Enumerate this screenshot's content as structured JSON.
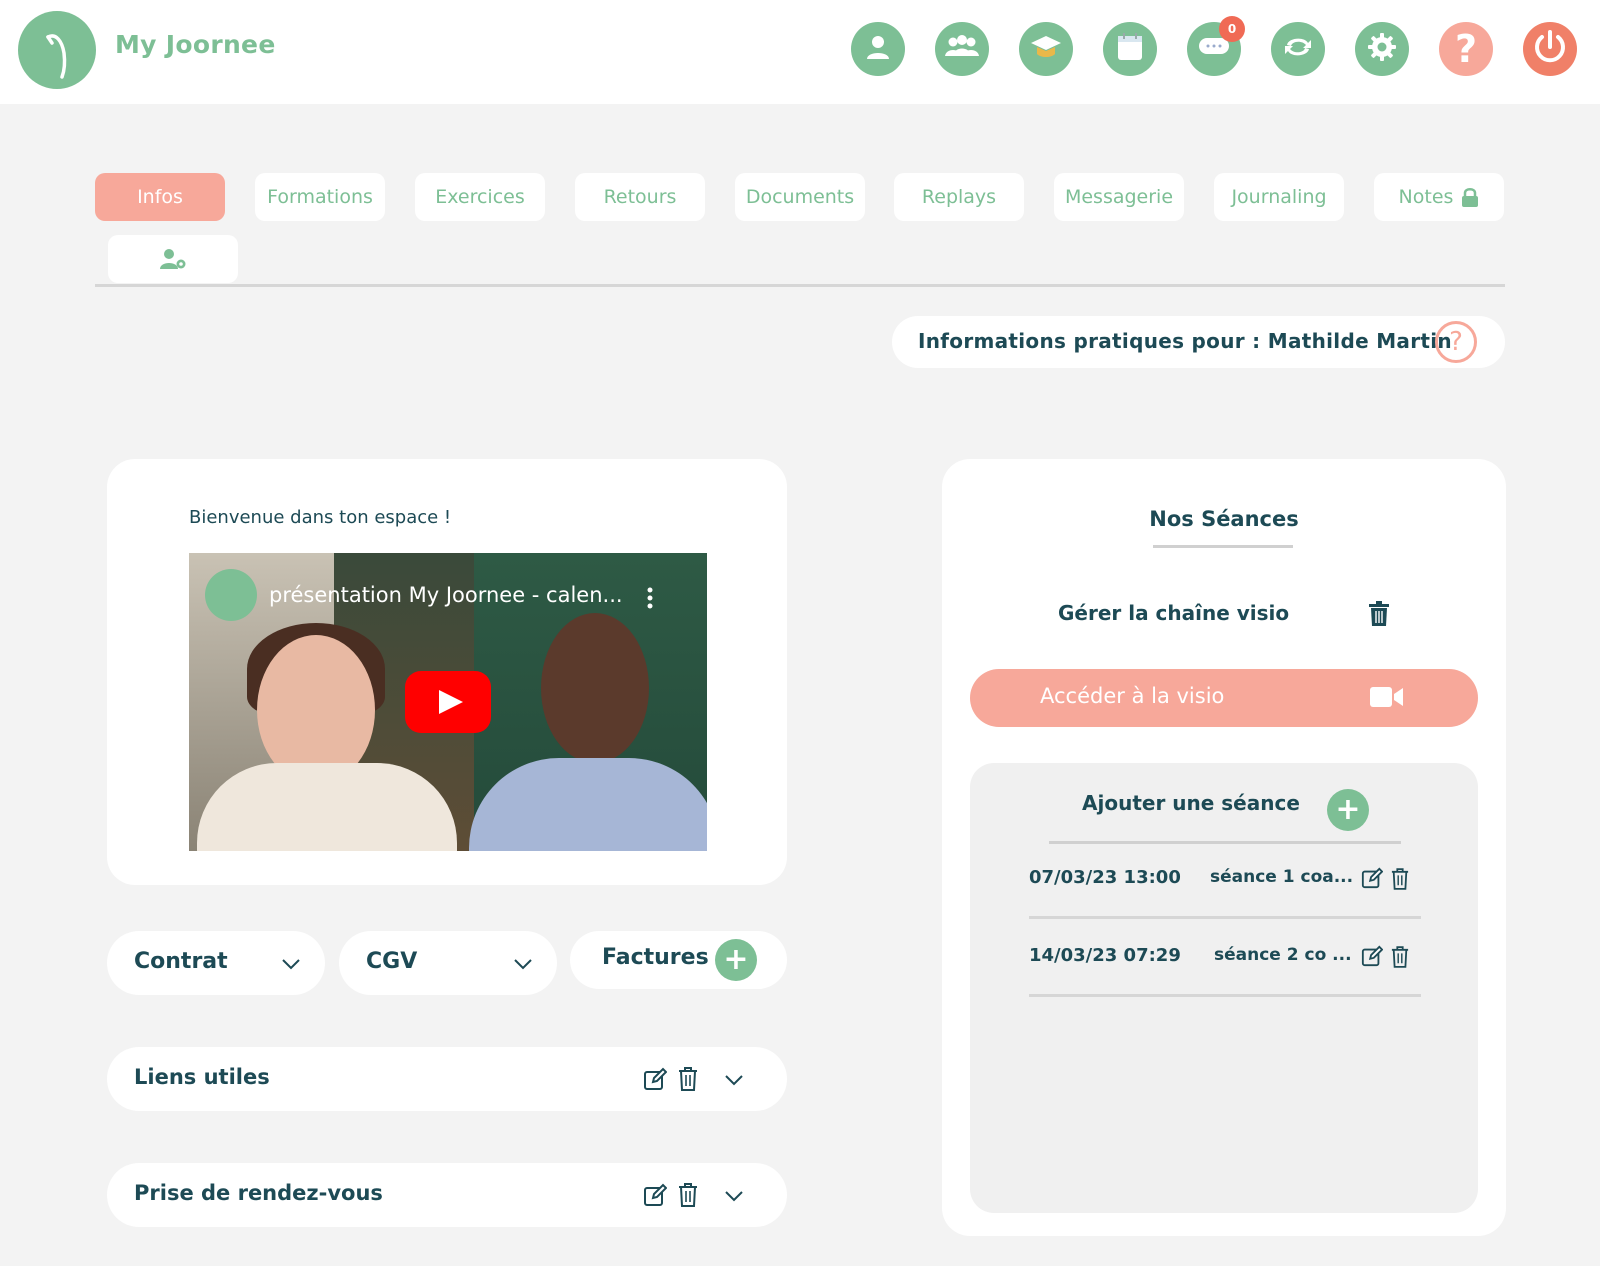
{
  "app": {
    "name": "My Joornee"
  },
  "header": {
    "icons": [
      "user-icon",
      "group-icon",
      "graduation-cap-icon",
      "calendar-icon",
      "chat-icon",
      "sync-icon",
      "gear-icon",
      "help-icon",
      "power-icon"
    ],
    "chat_badge": "0"
  },
  "tabs": [
    "Infos",
    "Formations",
    "Exercices",
    "Retours",
    "Documents",
    "Replays",
    "Messagerie",
    "Journaling",
    "Notes"
  ],
  "info_bar": {
    "text": "Informations pratiques pour : Mathilde Martin",
    "help": "?"
  },
  "welcome": {
    "title": "Bienvenue dans ton espace !",
    "video_title": "présentation My Joornee - calen..."
  },
  "docs": {
    "contract": "Contrat",
    "cgv": "CGV",
    "invoices": "Factures",
    "links": "Liens utiles",
    "appointments": "Prise de rendez-vous"
  },
  "sessions": {
    "title": "Nos Séances",
    "chain": "Gérer la chaîne visio",
    "visio_button": "Accéder à la visio",
    "add_title": "Ajouter une séance",
    "list": [
      {
        "date": "07/03/23 13:00",
        "name": "séance 1 coa..."
      },
      {
        "date": "14/03/23 07:29",
        "name": "séance 2 co ..."
      }
    ]
  },
  "colors": {
    "green": "#7dbf95",
    "coral": "#f7a89a",
    "power": "#f08068",
    "text": "#1d4a55",
    "background": "#f3f3f3"
  }
}
